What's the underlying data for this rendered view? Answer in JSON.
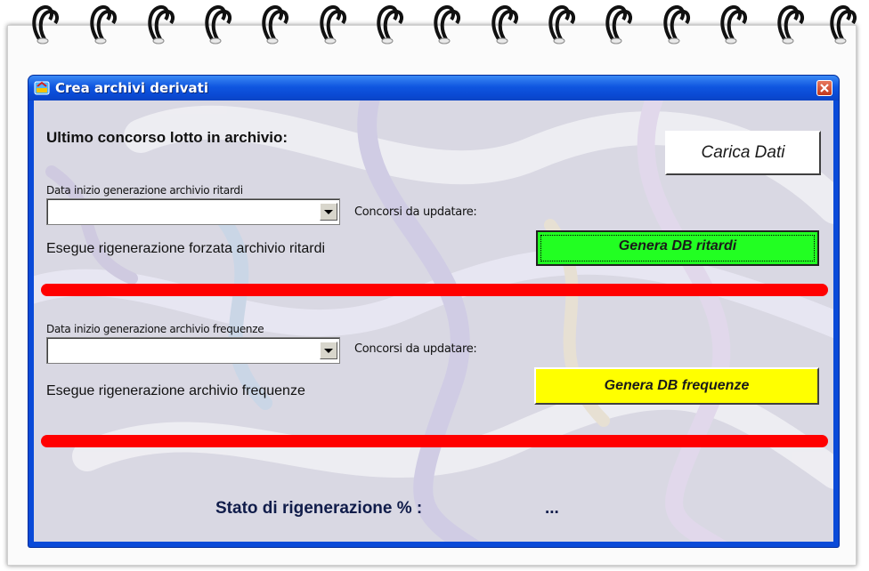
{
  "window": {
    "title": "Crea archivi derivati"
  },
  "header": {
    "last_contest_label": "Ultimo concorso lotto in archivio:",
    "load_button": "Carica Dati"
  },
  "ritardi": {
    "start_label": "Data inizio generazione archivio ritardi",
    "start_value": "",
    "update_label": "Concorsi da updatare:",
    "force_label": "Esegue rigenerazione forzata archivio ritardi",
    "generate_button": "Genera DB ritardi",
    "button_color": "#22ff22"
  },
  "frequenze": {
    "start_label": "Data inizio generazione archivio frequenze",
    "start_value": "",
    "update_label": "Concorsi da updatare:",
    "regen_label": "Esegue rigenerazione archivio frequenze",
    "generate_button": "Genera DB frequenze",
    "button_color": "#ffff00"
  },
  "status": {
    "label": "Stato di rigenerazione % :",
    "value": "..."
  },
  "colors": {
    "titlebar": "#0a4ad8",
    "progress_bar": "#ff0000"
  },
  "icons": [
    "app-icon",
    "close-icon",
    "chevron-down-icon"
  ]
}
